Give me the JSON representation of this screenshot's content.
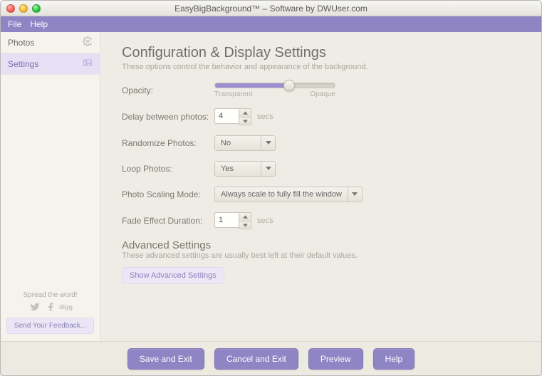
{
  "window": {
    "title": "EasyBigBackground™ – Software by DWUser.com"
  },
  "menubar": {
    "file": "File",
    "help": "Help"
  },
  "sidebar": {
    "items": [
      {
        "label": "Photos"
      },
      {
        "label": "Settings"
      }
    ],
    "spread_label": "Spread the word!",
    "feedback_label": "Send Your Feedback..."
  },
  "main": {
    "heading": "Configuration & Display Settings",
    "subheading": "These options control the behavior and appearance of the background.",
    "opacity": {
      "label": "Opacity:",
      "min_label": "Transparent",
      "max_label": "Opaque",
      "value_percent": 62
    },
    "delay": {
      "label": "Delay between photos:",
      "value": "4",
      "unit": "secs"
    },
    "randomize": {
      "label": "Randomize Photos:",
      "value": "No"
    },
    "loop": {
      "label": "Loop Photos:",
      "value": "Yes"
    },
    "scaling": {
      "label": "Photo Scaling Mode:",
      "value": "Always scale to fully fill the window"
    },
    "fade": {
      "label": "Fade Effect Duration:",
      "value": "1",
      "unit": "secs"
    },
    "advanced": {
      "heading": "Advanced Settings",
      "subheading": "These advanced settings are usually best left at their default values.",
      "button": "Show Advanced Settings"
    }
  },
  "footer": {
    "save": "Save and Exit",
    "cancel": "Cancel and Exit",
    "preview": "Preview",
    "help": "Help"
  }
}
